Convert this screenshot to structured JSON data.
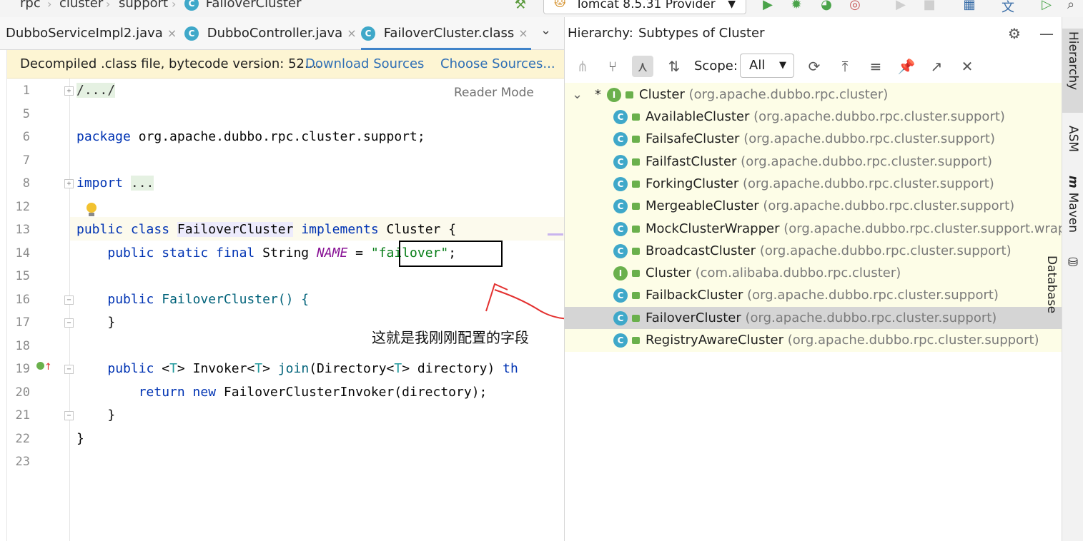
{
  "breadcrumbs": [
    "rpc",
    "cluster",
    "support",
    "FailoverCluster"
  ],
  "run_config": {
    "label": "Tomcat 8.5.31 Provider"
  },
  "tabs": [
    {
      "label": "DubboServiceImpl2.java",
      "active": false,
      "close": "×"
    },
    {
      "label": "DubboController.java",
      "active": false,
      "close": "×"
    },
    {
      "label": "FailoverCluster.class",
      "active": true,
      "close": "×"
    }
  ],
  "banner": {
    "message": "Decompiled .class file, bytecode version: 52....",
    "download_sources": "Download Sources",
    "choose_sources": "Choose Sources..."
  },
  "editor": {
    "reader_mode": "Reader Mode",
    "line_numbers": [
      "1",
      "5",
      "6",
      "7",
      "8",
      "12",
      "13",
      "14",
      "15",
      "16",
      "17",
      "18",
      "19",
      "20",
      "21",
      "22",
      "23"
    ],
    "code": {
      "l1": "/.../",
      "pkg_kw": "package",
      "pkg_name": " org.apache.dubbo.rpc.cluster.support;",
      "import_kw": "import",
      "import_fold": "...",
      "class_public": "public",
      "class_kw": "class",
      "class_name": "FailoverCluster",
      "implements_kw": "implements",
      "implements_rest": " Cluster {",
      "field_mods": "public static final",
      "field_type": " String ",
      "field_name": "NAME",
      "field_eq": " = ",
      "field_value": "\"failover\"",
      "field_end": ";",
      "ctor_public": "public",
      "ctor_name": " FailoverCluster() {",
      "ctor_close": "}",
      "join_public": "public",
      "join_t1": " <",
      "join_T": "T",
      "join_t2": "> Invoker<",
      "join_T2": "T",
      "join_t3": "> ",
      "join_name": "join",
      "join_args1": "(Directory<",
      "join_T3": "T",
      "join_args2": "> directory) ",
      "join_throws": "th",
      "ret_kw": "return new",
      "ret_rest": " FailoverClusterInvoker(directory);",
      "join_close": "}",
      "class_close": "}"
    },
    "annotation": "这就是我刚刚配置的字段"
  },
  "hierarchy": {
    "title": "Hierarchy:",
    "subtitle": "Subtypes of Cluster",
    "scope_label": "Scope:",
    "scope_value": "All",
    "root": {
      "name": "Cluster",
      "pkg": "(org.apache.dubbo.rpc.cluster)",
      "star": "*"
    },
    "children": [
      {
        "name": "AvailableCluster",
        "pkg": "(org.apache.dubbo.rpc.cluster.support)",
        "kind": "C"
      },
      {
        "name": "FailsafeCluster",
        "pkg": "(org.apache.dubbo.rpc.cluster.support)",
        "kind": "C"
      },
      {
        "name": "FailfastCluster",
        "pkg": "(org.apache.dubbo.rpc.cluster.support)",
        "kind": "C"
      },
      {
        "name": "ForkingCluster",
        "pkg": "(org.apache.dubbo.rpc.cluster.support)",
        "kind": "C"
      },
      {
        "name": "MergeableCluster",
        "pkg": "(org.apache.dubbo.rpc.cluster.support)",
        "kind": "C"
      },
      {
        "name": "MockClusterWrapper",
        "pkg": "(org.apache.dubbo.rpc.cluster.support.wrapp",
        "kind": "C"
      },
      {
        "name": "BroadcastCluster",
        "pkg": "(org.apache.dubbo.rpc.cluster.support)",
        "kind": "C"
      },
      {
        "name": "Cluster",
        "pkg": "(com.alibaba.dubbo.rpc.cluster)",
        "kind": "I"
      },
      {
        "name": "FailbackCluster",
        "pkg": "(org.apache.dubbo.rpc.cluster.support)",
        "kind": "C"
      },
      {
        "name": "FailoverCluster",
        "pkg": "(org.apache.dubbo.rpc.cluster.support)",
        "kind": "C"
      },
      {
        "name": "RegistryAwareCluster",
        "pkg": "(org.apache.dubbo.rpc.cluster.support)",
        "kind": "C"
      }
    ],
    "selected_index": 9
  },
  "right_strip": [
    "Hierarchy",
    "ASM",
    "Maven",
    "Database"
  ],
  "colors": {
    "keyword": "#0033b3",
    "string": "#067d17",
    "field": "#871094",
    "link": "#2f6fb5",
    "banner_bg": "#fdf5d3",
    "tree_bg": "#fdfde7"
  }
}
